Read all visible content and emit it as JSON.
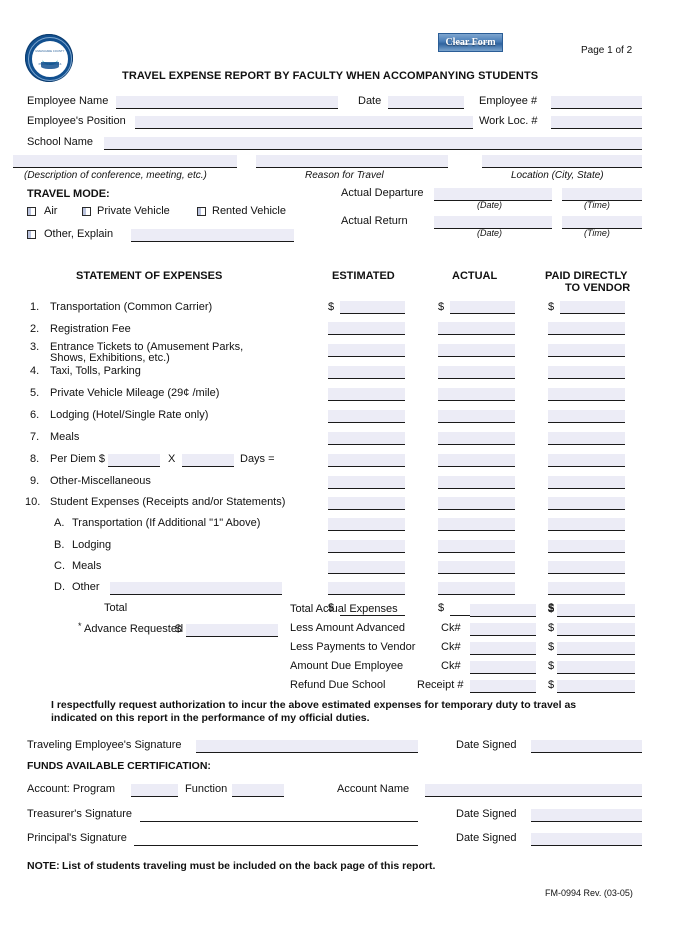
{
  "header": {
    "clear_form_label": "Clear Form",
    "page_indicator": "Page 1 of 2",
    "title": "TRAVEL EXPENSE REPORT BY FACULTY WHEN ACCOMPANYING STUDENTS",
    "logo_text_top": "MIAMI-DADE COUNTY",
    "logo_text_bottom": "PUBLIC SCHOOLS",
    "accent_color": "#12508f",
    "field_fill_color": "#ececf6"
  },
  "identity": {
    "employee_name_label": "Employee Name",
    "employee_name_value": "",
    "date_label": "Date",
    "date_value": "",
    "employee_num_label": "Employee #",
    "employee_num_value": "",
    "position_label": "Employee's Position",
    "position_value": "",
    "work_loc_label": "Work Loc. #",
    "work_loc_value": "",
    "school_name_label": "School Name",
    "school_name_value": "",
    "description_value": "",
    "description_caption": "(Description of conference, meeting, etc.)",
    "reason_value": "",
    "reason_caption": "Reason for Travel",
    "location_value": "",
    "location_caption": "Location (City, State)"
  },
  "travel_mode": {
    "heading": "TRAVEL MODE:",
    "options": [
      {
        "label": "Air",
        "checked": false
      },
      {
        "label": "Private Vehicle",
        "checked": false
      },
      {
        "label": "Rented Vehicle",
        "checked": false
      }
    ],
    "other_label": "Other, Explain",
    "other_value": ""
  },
  "travel_times": {
    "departure_label": "Actual Departure",
    "departure_date_value": "",
    "departure_time_value": "",
    "return_label": "Actual Return",
    "return_date_value": "",
    "return_time_value": "",
    "date_caption": "(Date)",
    "time_caption": "(Time)"
  },
  "expenses": {
    "section_title": "STATEMENT OF EXPENSES",
    "col_estimated": "ESTIMATED",
    "col_actual": "ACTUAL",
    "col_paid_line1": "PAID DIRECTLY",
    "col_paid_line2": "TO VENDOR",
    "currency_symbol": "$",
    "rows": [
      {
        "num": "1.",
        "label": "Transportation (Common Carrier)",
        "label2": "",
        "estimated": "",
        "actual": "",
        "paid": ""
      },
      {
        "num": "2.",
        "label": "Registration Fee",
        "label2": "",
        "estimated": "",
        "actual": "",
        "paid": ""
      },
      {
        "num": "3.",
        "label": "Entrance Tickets to (Amusement Parks,",
        "label2": "Shows, Exhibitions, etc.)",
        "estimated": "",
        "actual": "",
        "paid": ""
      },
      {
        "num": "4.",
        "label": "Taxi, Tolls, Parking",
        "label2": "",
        "estimated": "",
        "actual": "",
        "paid": ""
      },
      {
        "num": "5.",
        "label": "Private Vehicle Mileage (29¢ /mile)",
        "label2": "",
        "estimated": "",
        "actual": "",
        "paid": ""
      },
      {
        "num": "6.",
        "label": "Lodging (Hotel/Single Rate only)",
        "label2": "",
        "estimated": "",
        "actual": "",
        "paid": ""
      },
      {
        "num": "7.",
        "label": "Meals",
        "label2": "",
        "estimated": "",
        "actual": "",
        "paid": ""
      },
      {
        "num": "8.",
        "label": "Per Diem $",
        "label2": "",
        "estimated": "",
        "actual": "",
        "paid": ""
      },
      {
        "num": "9.",
        "label": "Other-Miscellaneous",
        "label2": "",
        "estimated": "",
        "actual": "",
        "paid": ""
      },
      {
        "num": "10.",
        "label": "Student Expenses (Receipts and/or Statements)",
        "label2": "",
        "estimated": "",
        "actual": "",
        "paid": ""
      },
      {
        "num": "A.",
        "label": "Transportation (If Additional \"1\" Above)",
        "label2": "",
        "estimated": "",
        "actual": "",
        "paid": ""
      },
      {
        "num": "B.",
        "label": "Lodging",
        "label2": "",
        "estimated": "",
        "actual": "",
        "paid": ""
      },
      {
        "num": "C.",
        "label": "Meals",
        "label2": "",
        "estimated": "",
        "actual": "",
        "paid": ""
      },
      {
        "num": "D.",
        "label": "Other",
        "label2": "",
        "estimated": "",
        "actual": "",
        "paid": ""
      }
    ],
    "per_diem_rate_value": "",
    "per_diem_multiplier": "X",
    "per_diem_days_value": "",
    "per_diem_days_label": "Days  =",
    "other_d_value": "",
    "total_label": "Total",
    "total_estimated": "",
    "total_actual": "",
    "total_paid": "",
    "advance_label": "Advance Requested",
    "advance_asterisk": "*",
    "advance_value": ""
  },
  "summary": {
    "rows": [
      {
        "label": "Total Actual Expenses",
        "ref_label": "",
        "ref_value": "",
        "amount": ""
      },
      {
        "label": "Less Amount Advanced",
        "ref_label": "Ck#",
        "ref_value": "",
        "amount": ""
      },
      {
        "label": "Less Payments to Vendor",
        "ref_label": "Ck#",
        "ref_value": "",
        "amount": ""
      },
      {
        "label": "Amount Due Employee",
        "ref_label": "Ck#",
        "ref_value": "",
        "amount": ""
      },
      {
        "label": "Refund Due School",
        "ref_label": "Receipt #",
        "ref_value": "",
        "amount": ""
      }
    ],
    "currency_symbol": "$"
  },
  "certification": {
    "statement_line1": "I respectfully request authorization to incur the above estimated expenses for temporary duty to travel as",
    "statement_line2": "indicated on this report in the performance of my official duties.",
    "employee_signature_label": "Traveling Employee's Signature",
    "employee_signature_value": "",
    "employee_date_label": "Date Signed",
    "employee_date_value": ""
  },
  "funds": {
    "heading": "FUNDS AVAILABLE CERTIFICATION:",
    "account_label": "Account:  Program",
    "program_value": "",
    "function_label": "Function",
    "function_value": "",
    "account_name_label": "Account Name",
    "account_name_value": "",
    "treasurer_label": "Treasurer's Signature",
    "treasurer_value": "",
    "treasurer_date_label": "Date Signed",
    "treasurer_date_value": "",
    "principal_label": "Principal's Signature",
    "principal_value": "",
    "principal_date_label": "Date Signed",
    "principal_date_value": ""
  },
  "footer": {
    "note_bold": "NOTE:",
    "note_text": "List of students traveling must be included on the back page of this report.",
    "form_code": "FM-0994 Rev. (03-05)"
  }
}
